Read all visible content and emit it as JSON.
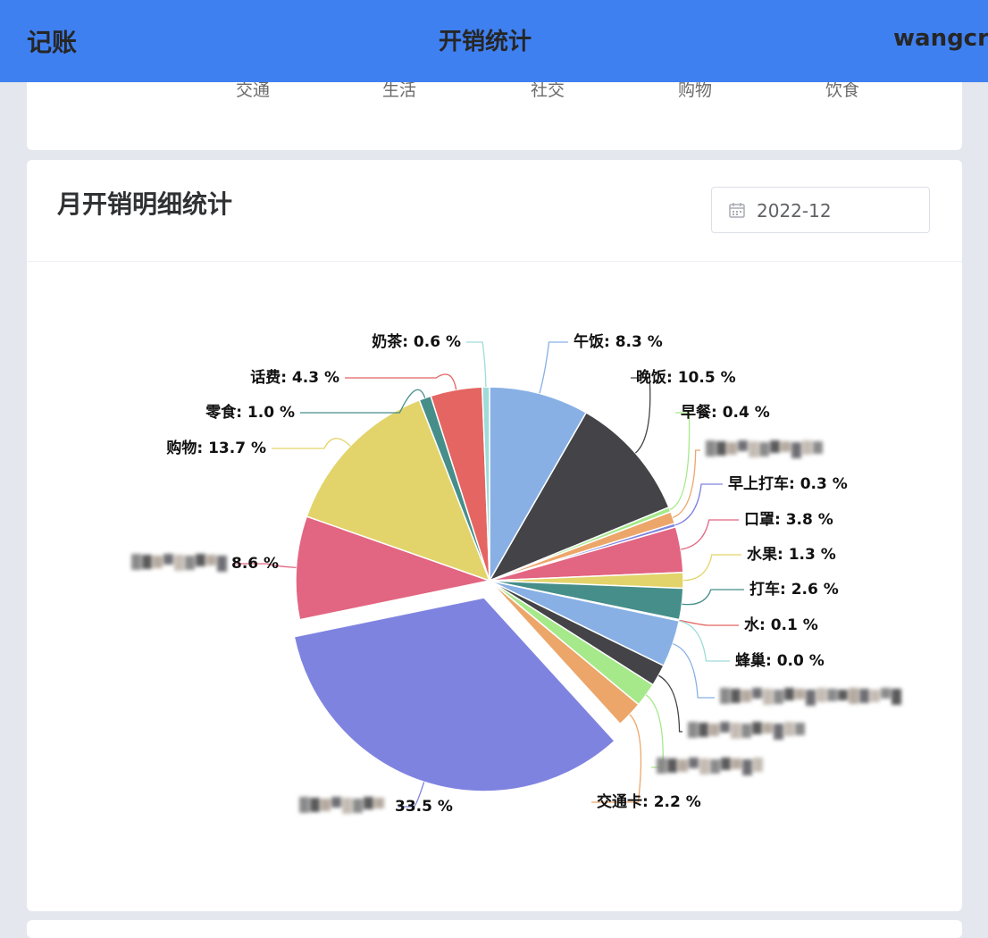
{
  "header": {
    "brand": "记账",
    "page_title": "开销统计",
    "user": "wangcr"
  },
  "top_card": {
    "tabs": [
      "交通",
      "生活",
      "社交",
      "购物",
      "饮食"
    ]
  },
  "detail_card": {
    "title": "月开销明细统计",
    "date_value": "2022-12",
    "date_icon": "calendar-icon"
  },
  "chart_data": {
    "type": "pie",
    "slices": [
      {
        "name": "午饭",
        "value": 8.3,
        "color": "#88b0e5",
        "label": "午饭: 8.3 %"
      },
      {
        "name": "晚饭",
        "value": 10.5,
        "color": "#434348",
        "label": "晚饭: 10.5 %"
      },
      {
        "name": "早餐",
        "value": 0.4,
        "color": "#a5e98a",
        "label": "早餐: 0.4 %"
      },
      {
        "name": "",
        "value": 1.0,
        "color": "#eca66a",
        "label": "",
        "obscured": true
      },
      {
        "name": "早上打车",
        "value": 0.3,
        "color": "#7f83e0",
        "label": "早上打车: 0.3 %"
      },
      {
        "name": "口罩",
        "value": 3.8,
        "color": "#e26581",
        "label": "口罩: 3.8 %"
      },
      {
        "name": "水果",
        "value": 1.3,
        "color": "#e2d46a",
        "label": "水果: 1.3 %"
      },
      {
        "name": "打车",
        "value": 2.6,
        "color": "#468e8a",
        "label": "打车: 2.6 %"
      },
      {
        "name": "水",
        "value": 0.1,
        "color": "#e46562",
        "label": "水: 0.1 %"
      },
      {
        "name": "蜂巢",
        "value": 0.0,
        "color": "#9fdcd9",
        "label": "蜂巢: 0.0 %"
      },
      {
        "name": "",
        "value": 3.9,
        "color": "#88b0e5",
        "label": "",
        "obscured": true
      },
      {
        "name": "",
        "value": 1.8,
        "color": "#434348",
        "label": "",
        "obscured": true
      },
      {
        "name": "",
        "value": 2.0,
        "color": "#a5e98a",
        "label": "",
        "obscured": true
      },
      {
        "name": "交通卡",
        "value": 2.2,
        "color": "#eca66a",
        "label": "交通卡: 2.2 %"
      },
      {
        "name": "",
        "value": 33.5,
        "color": "#7f83e0",
        "label": "33.5 %",
        "obscured": true,
        "sliced": true
      },
      {
        "name": "",
        "value": 8.6,
        "color": "#e26581",
        "label": "8.6 %",
        "obscured": true
      },
      {
        "name": "购物",
        "value": 13.7,
        "color": "#e2d46a",
        "label": "购物: 13.7 %"
      },
      {
        "name": "零食",
        "value": 1.0,
        "color": "#468e8a",
        "label": "零食: 1.0 %"
      },
      {
        "name": "话费",
        "value": 4.3,
        "color": "#e46562",
        "label": "话费: 4.3 %"
      },
      {
        "name": "奶茶",
        "value": 0.6,
        "color": "#9fdcd9",
        "label": "奶茶: 0.6 %"
      }
    ]
  }
}
